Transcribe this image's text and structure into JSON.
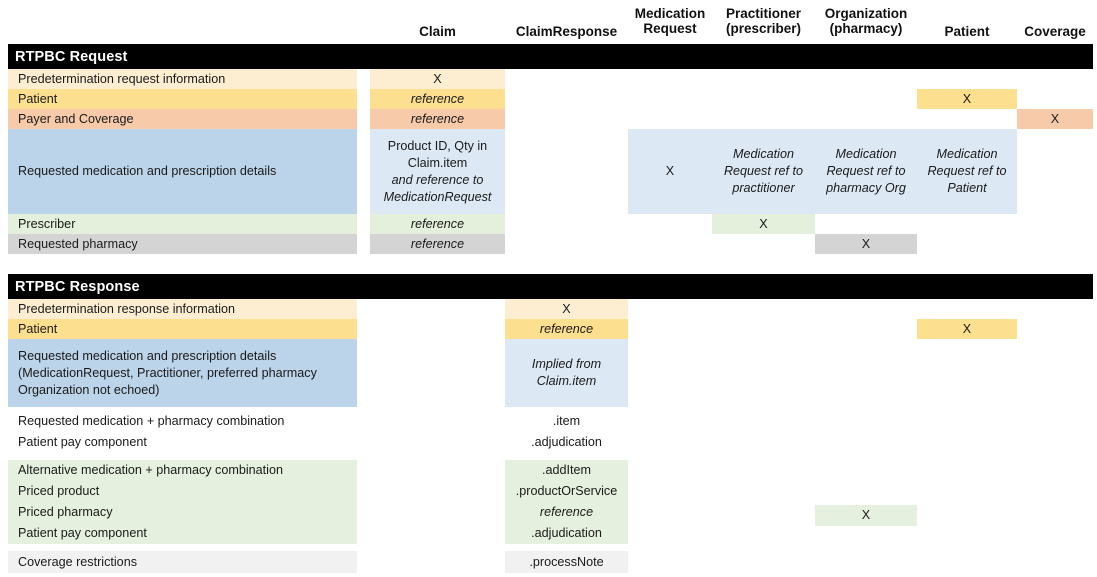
{
  "columns": [
    {
      "id": "claim",
      "label": "Claim"
    },
    {
      "id": "claimresponse",
      "label": "ClaimResponse"
    },
    {
      "id": "medicationrequest",
      "label": "Medication\nRequest"
    },
    {
      "id": "practitioner",
      "label": "Practitioner\n(prescriber)"
    },
    {
      "id": "organization",
      "label": "Organization\n(pharmacy)"
    },
    {
      "id": "patient",
      "label": "Patient"
    },
    {
      "id": "coverage",
      "label": "Coverage"
    }
  ],
  "sections": [
    {
      "id": "request",
      "banner": "RTPBC Request",
      "rows": [
        {
          "label": "Predetermination request information",
          "claim": "X"
        },
        {
          "label": "Patient",
          "claim": "reference",
          "patient": "X"
        },
        {
          "label": "Payer and Coverage",
          "claim": "reference",
          "coverage": "X"
        },
        {
          "label": "Requested medication and prescription details",
          "claim_line1": "Product ID, Qty in",
          "claim_line2": "Claim.item",
          "claim_line3": "and reference to",
          "claim_line4": "MedicationRequest",
          "medicationrequest": "X",
          "practitioner_line1": "Medication",
          "practitioner_line2": "Request ref to",
          "practitioner_line3": "practitioner",
          "organization_line1": "Medication",
          "organization_line2": "Request ref to",
          "organization_line3": "pharmacy Org",
          "patient_line1": "Medication",
          "patient_line2": "Request ref to",
          "patient_line3": "Patient"
        },
        {
          "label": "Prescriber",
          "claim": "reference",
          "practitioner": "X"
        },
        {
          "label": "Requested pharmacy",
          "claim": "reference",
          "organization": "X"
        }
      ]
    },
    {
      "id": "response",
      "banner": "RTPBC Response",
      "rows": [
        {
          "label": "Predetermination response information",
          "claimresponse": "X"
        },
        {
          "label": "Patient",
          "claimresponse": "reference",
          "patient": "X"
        },
        {
          "label_line1": "Requested medication and prescription details",
          "label_line2": "(MedicationRequest, Practitioner, preferred pharmacy",
          "label_line3": "Organization not echoed)",
          "claimresponse_line1": "Implied from",
          "claimresponse_line2": "Claim.item"
        },
        {
          "label": "Requested medication + pharmacy combination",
          "claimresponse": ".item"
        },
        {
          "label": "Patient pay component",
          "claimresponse": ".adjudication"
        },
        {
          "label": "Alternative medication + pharmacy combination",
          "claimresponse": ".addItem"
        },
        {
          "label": "Priced product",
          "claimresponse": ".productOrService"
        },
        {
          "label": "Priced pharmacy",
          "claimresponse": "reference",
          "organization": "X"
        },
        {
          "label": "Patient pay component",
          "claimresponse": ".adjudication"
        },
        {
          "label": "Coverage restrictions",
          "claimresponse": ".processNote"
        }
      ]
    }
  ],
  "palette": {
    "cream": "#fdeed2",
    "yellow": "#fcdf8f",
    "peach": "#f7cbaa",
    "blue_dark": "#bcd4ea",
    "blue_light": "#dce8f4",
    "green_dark": "#e4efdc",
    "green_light": "#e6f0de",
    "gray_dark": "#d4d4d4",
    "gray_light": "#f1f1f1",
    "banner": "#000000"
  }
}
